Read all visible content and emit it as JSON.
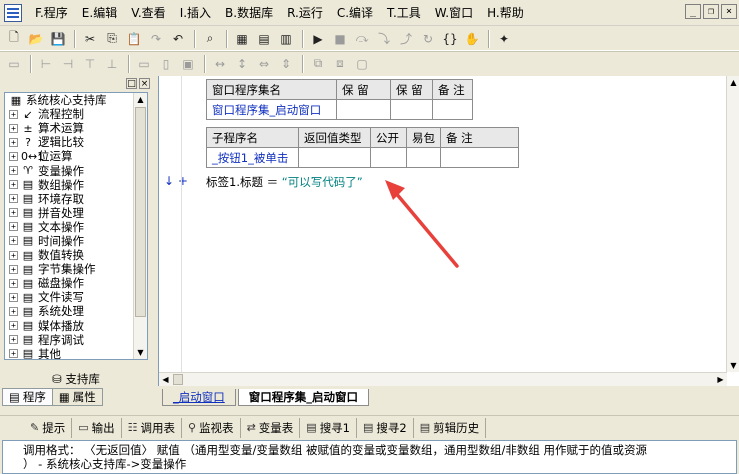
{
  "menu": {
    "items": [
      "F.程序",
      "E.编辑",
      "V.查看",
      "I.插入",
      "B.数据库",
      "R.运行",
      "C.编译",
      "T.工具",
      "W.窗口",
      "H.帮助"
    ]
  },
  "window_controls": {
    "minimize": "_",
    "restore": "❐",
    "close": "×"
  },
  "left_panel": {
    "tree_root": "系统核心支持库",
    "tree_items": [
      {
        "label": "流程控制",
        "icon": "↙"
      },
      {
        "label": "算术运算",
        "icon": "±"
      },
      {
        "label": "逻辑比较",
        "icon": "?"
      },
      {
        "label": "位运算",
        "icon": "0↔1"
      },
      {
        "label": "变量操作",
        "icon": "♈"
      },
      {
        "label": "数组操作",
        "icon": "▤"
      },
      {
        "label": "环境存取",
        "icon": "▤"
      },
      {
        "label": "拼音处理",
        "icon": "▤"
      },
      {
        "label": "文本操作",
        "icon": "▤"
      },
      {
        "label": "时间操作",
        "icon": "▤"
      },
      {
        "label": "数值转换",
        "icon": "▤"
      },
      {
        "label": "字节集操作",
        "icon": "▤"
      },
      {
        "label": "磁盘操作",
        "icon": "▤"
      },
      {
        "label": "文件读写",
        "icon": "▤"
      },
      {
        "label": "系统处理",
        "icon": "▤"
      },
      {
        "label": "媒体播放",
        "icon": "▤"
      },
      {
        "label": "程序调试",
        "icon": "▤"
      },
      {
        "label": "其他",
        "icon": "▤"
      }
    ],
    "support_lib_label": "支持库",
    "tabs": [
      {
        "label": "程序"
      },
      {
        "label": "属性"
      }
    ]
  },
  "editor": {
    "window_table": {
      "headers": [
        "窗口程序集名",
        "保 留",
        "保 留",
        "备 注"
      ],
      "row": [
        "窗口程序集_启动窗口",
        "",
        "",
        ""
      ]
    },
    "sub_table": {
      "headers": [
        "子程序名",
        "返回值类型",
        "公开",
        "易包",
        "备 注"
      ],
      "row": [
        "_按钮1_被单击",
        "",
        "",
        "",
        ""
      ]
    },
    "gutter": "↓ +",
    "code": {
      "lhs": "标签1.标题 ＝ ",
      "rhs": "“可以写代码了”"
    },
    "annotation_color": "#e8403a"
  },
  "editor_tabs": [
    {
      "label": "_启动窗口",
      "active": false
    },
    {
      "label": "窗口程序集_启动窗口",
      "active": true
    }
  ],
  "bottom": {
    "tabs": [
      {
        "label": "提示",
        "icon": "✎"
      },
      {
        "label": "输出",
        "icon": "▭"
      },
      {
        "label": "调用表",
        "icon": "☷"
      },
      {
        "label": "监视表",
        "icon": "⚲"
      },
      {
        "label": "变量表",
        "icon": "⇄"
      },
      {
        "label": "搜寻1",
        "icon": "▤"
      },
      {
        "label": "搜寻2",
        "icon": "▤"
      },
      {
        "label": "剪辑历史",
        "icon": "▤"
      }
    ],
    "output_lines": [
      "调用格式： 〈无返回值〉 赋值 （通用型变量/变量数组 被赋值的变量或变量数组，通用型数组/非数组 用作赋于的值或资源",
      "） - 系统核心支持库->变量操作"
    ]
  }
}
